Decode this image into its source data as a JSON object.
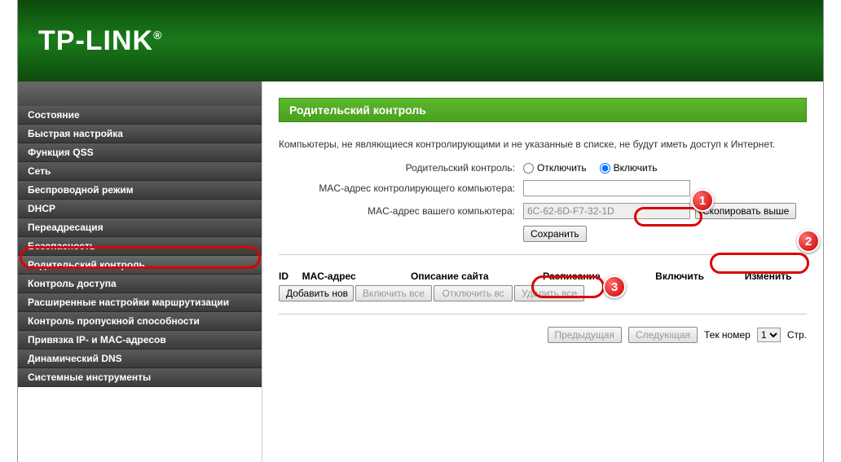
{
  "header": {
    "logo": "TP-LINK"
  },
  "sidebar": {
    "items": [
      {
        "label": "Состояние"
      },
      {
        "label": "Быстрая настройка"
      },
      {
        "label": "Функция QSS"
      },
      {
        "label": "Сеть"
      },
      {
        "label": "Беспроводной режим"
      },
      {
        "label": "DHCP"
      },
      {
        "label": "Переадресация"
      },
      {
        "label": "Безопасность"
      },
      {
        "label": "Родительский контроль"
      },
      {
        "label": "Контроль доступа"
      },
      {
        "label": "Расширенные настройки маршрутизации"
      },
      {
        "label": "Контроль пропускной способности"
      },
      {
        "label": "Привязка IP- и MAC-адресов"
      },
      {
        "label": "Динамический DNS"
      },
      {
        "label": "Системные инструменты"
      }
    ]
  },
  "main": {
    "title": "Родительский контроль",
    "info": "Компьютеры, не являющиеся контролирующими и не указанные в списке, не будут иметь доступ к Интернет.",
    "form": {
      "parental_label": "Родительский контроль:",
      "disable": "Отключить",
      "enable": "Включить",
      "control_mac_label": "MAC-адрес контролирующего компьютера:",
      "control_mac_value": "",
      "your_mac_label": "MAC-адрес вашего компьютера:",
      "your_mac_value": "6C-62-6D-F7-32-1D",
      "copy_btn": "Скопировать выше",
      "save_btn": "Сохранить"
    },
    "table": {
      "headers": [
        "ID",
        "MAC-адрес",
        "Описание сайта",
        "Расписание",
        "Включить",
        "Изменить"
      ]
    },
    "toolbar": {
      "add": "Добавить нов",
      "enable_all": "Включить все",
      "disable_all": "Отключить вс",
      "delete_all": "Удалить все"
    },
    "pagination": {
      "prev": "Предыдущая",
      "next": "Следующая",
      "label": "Тек номер",
      "page": "1",
      "suffix": "Стр."
    }
  },
  "annotations": {
    "badge1": "1",
    "badge2": "2",
    "badge3": "3"
  }
}
